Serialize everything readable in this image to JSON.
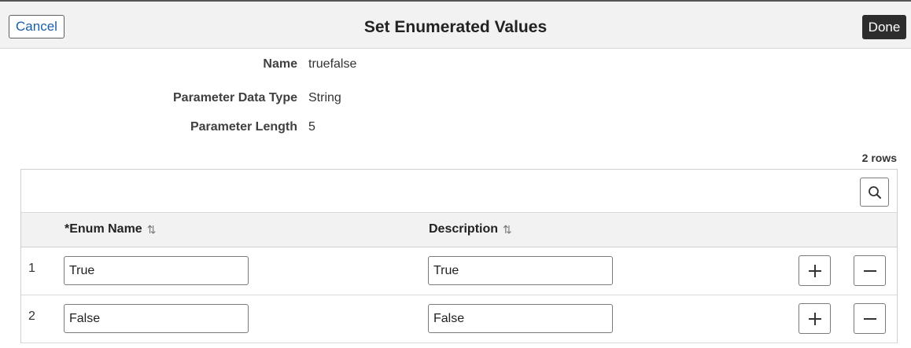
{
  "header": {
    "cancel_label": "Cancel",
    "title": "Set Enumerated Values",
    "done_label": "Done"
  },
  "fields": [
    {
      "label": "Name",
      "value": "truefalse"
    },
    {
      "label": "Parameter Data Type",
      "value": "String"
    },
    {
      "label": "Parameter Length",
      "value": "5"
    }
  ],
  "grid": {
    "row_count_label": "2 rows",
    "columns": [
      {
        "label": "*Enum Name",
        "sort_glyph": "⇅"
      },
      {
        "label": "Description",
        "sort_glyph": "⇅"
      }
    ],
    "rows": [
      {
        "num": "1",
        "enum_name": "True",
        "description": "True"
      },
      {
        "num": "2",
        "enum_name": "False",
        "description": "False"
      }
    ]
  },
  "icons": {
    "search": "search-icon",
    "add": "plus-icon",
    "remove": "minus-icon",
    "sort": "sort-icon"
  },
  "colors": {
    "header_bg": "#f2f2f2",
    "done_bg": "#2d2d2d",
    "cancel_text": "#1a5ea8"
  }
}
